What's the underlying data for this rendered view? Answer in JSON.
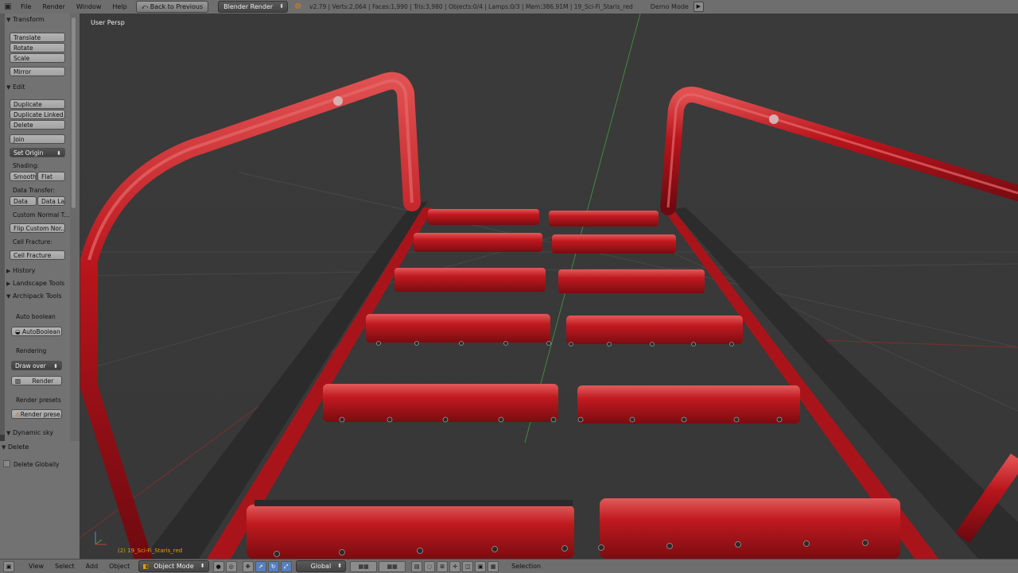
{
  "topbar": {
    "menus": [
      "File",
      "Render",
      "Window",
      "Help"
    ],
    "back_button": "Back to Previous",
    "engine": "Blender Render",
    "stats": "v2.79 | Verts:2,064 | Faces:1,990 | Tris:3,980 | Objects:0/4 | Lamps:0/3 | Mem:386.91M | 19_Sci-Fi_Staris_red",
    "demo_mode": "Demo Mode"
  },
  "toolshelf": {
    "transform_header": "Transform",
    "translate": "Translate",
    "rotate": "Rotate",
    "scale": "Scale",
    "mirror": "Mirror",
    "edit_header": "Edit",
    "duplicate": "Duplicate",
    "duplicate_linked": "Duplicate Linked",
    "delete": "Delete",
    "join": "Join",
    "set_origin": "Set Origin",
    "shading_label": "Shading:",
    "smooth": "Smooth",
    "flat": "Flat",
    "data_transfer_label": "Data Transfer:",
    "data": "Data",
    "data_layout": "Data La",
    "custom_normal": "Custom Normal T...",
    "flip_custom_normals": "Flip Custom Nor...",
    "cell_fracture_label": "Cell Fracture:",
    "cell_fracture": "Cell Fracture",
    "history_header": "History",
    "landscape_header": "Landscape Tools",
    "archipack_header": "Archipack Tools",
    "auto_boolean_label": "Auto boolean",
    "autoboolean": "AutoBoolean",
    "rendering_label": "Rendering",
    "draw_over": "Draw over",
    "render": "Render",
    "render_presets_label": "Render presets",
    "render_presets": "Render prese...",
    "dynamic_sky_header": "Dynamic sky"
  },
  "operator_panel": {
    "header": "Delete",
    "option": "Delete Globally"
  },
  "viewport": {
    "view_name": "User Persp",
    "object_name": "(2) 19_Sci-Fi_Staris_red"
  },
  "bottombar": {
    "menus": [
      "View",
      "Select",
      "Add",
      "Object"
    ],
    "mode": "Object Mode",
    "orientation": "Global",
    "selection_label": "Selection"
  },
  "colors": {
    "rail_red": "#b8141c",
    "stringer_dark": "#2a2a2a",
    "background": "#3b3b3b",
    "accent_orange": "#e8a000"
  },
  "icons": [
    "blender-icon",
    "back-icon",
    "play-icon",
    "view3d-icon",
    "object-mode-icon",
    "shading-sphere-icon",
    "pivot-icon",
    "manipulator-icon",
    "layers-icon",
    "snap-icon"
  ]
}
